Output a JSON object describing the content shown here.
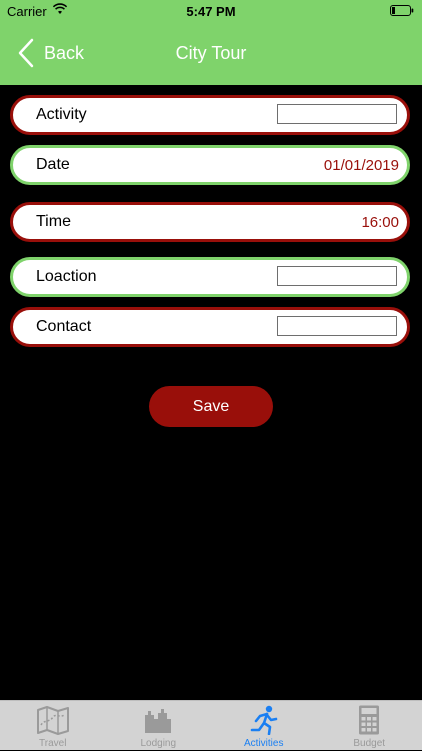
{
  "status": {
    "carrier": "Carrier",
    "time": "5:47 PM"
  },
  "nav": {
    "back_label": "Back",
    "title": "City Tour"
  },
  "form": {
    "activity": {
      "label": "Activity",
      "value": ""
    },
    "date": {
      "label": "Date",
      "value": "01/01/2019"
    },
    "time": {
      "label": "Time",
      "value": "16:00"
    },
    "location": {
      "label": "Loaction",
      "value": ""
    },
    "contact": {
      "label": "Contact",
      "value": ""
    }
  },
  "save_label": "Save",
  "tabs": [
    {
      "label": "Travel",
      "icon": "map-icon"
    },
    {
      "label": "Lodging",
      "icon": "castle-icon"
    },
    {
      "label": "Activities",
      "icon": "running-person-icon",
      "active": true
    },
    {
      "label": "Budget",
      "icon": "calculator-icon"
    }
  ],
  "colors": {
    "accent_green": "#7fd36b",
    "accent_red": "#990f0a",
    "active_tab": "#1a7ff2"
  }
}
